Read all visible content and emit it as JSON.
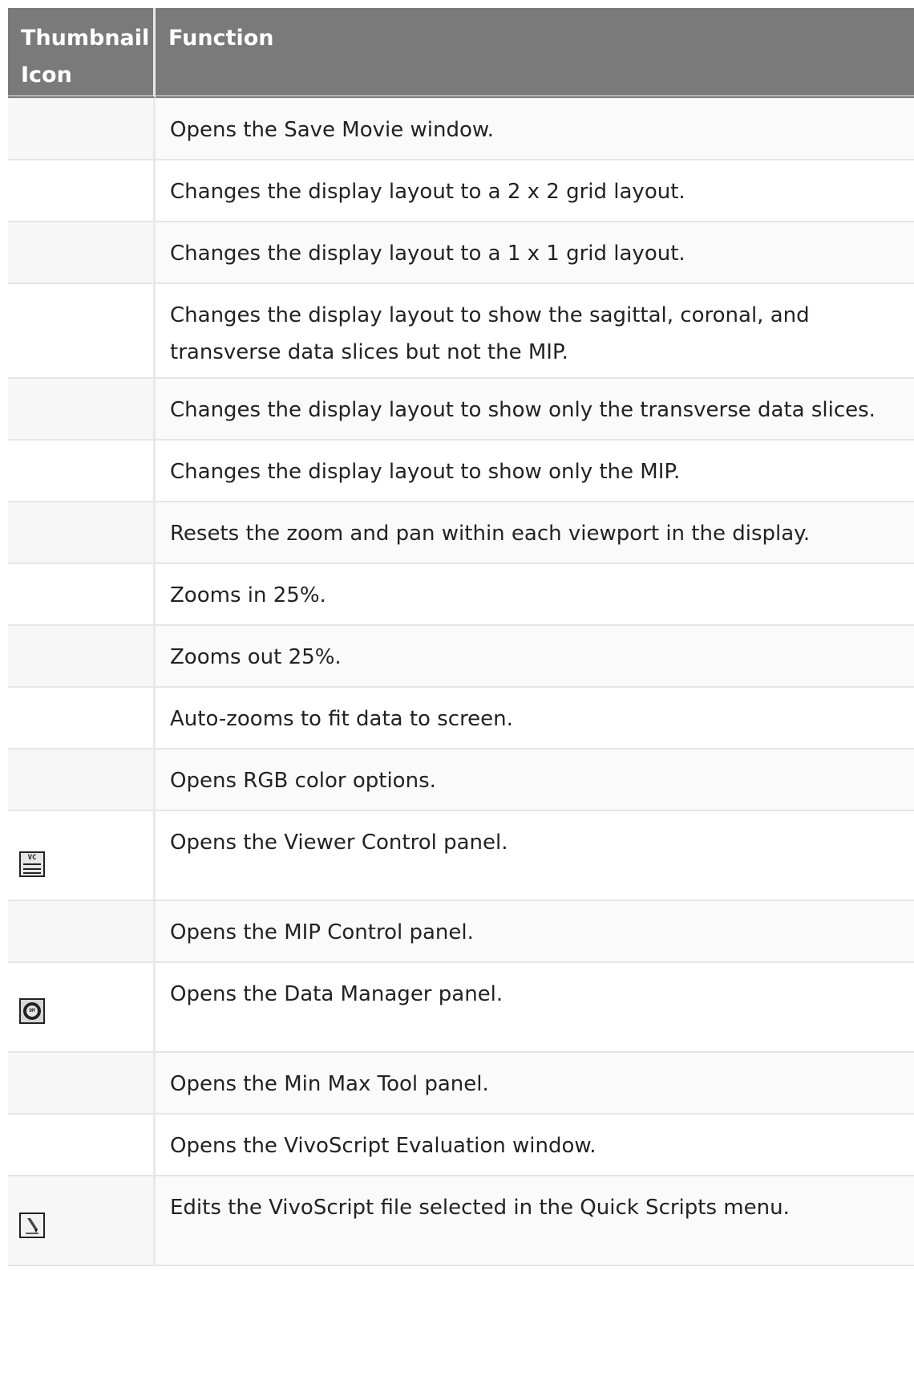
{
  "table": {
    "headers": [
      "Thumbnail Icon",
      "Function"
    ],
    "rows": [
      {
        "icon": "",
        "function": "Opens the Save Movie window."
      },
      {
        "icon": "",
        "function": "Changes the display layout to a 2 x 2 grid layout."
      },
      {
        "icon": "",
        "function": "Changes the display layout to a 1 x 1 grid layout."
      },
      {
        "icon": "",
        "function": "Changes the display layout to show the sagittal, coronal, and transverse data slices but not the MIP."
      },
      {
        "icon": "",
        "function": "Changes the display layout to show only the transverse data slices."
      },
      {
        "icon": "",
        "function": "Changes the display layout to show only the MIP."
      },
      {
        "icon": "",
        "function": "Resets the zoom and pan within each viewport in the display."
      },
      {
        "icon": "",
        "function": "Zooms in 25%."
      },
      {
        "icon": "",
        "function": "Zooms out 25%."
      },
      {
        "icon": "",
        "function": "Auto-zooms to fit data to screen."
      },
      {
        "icon": "",
        "function": "Opens RGB color options."
      },
      {
        "icon": "viewer-control-icon",
        "icon_text": "VC",
        "function": "Opens the Viewer Control panel."
      },
      {
        "icon": "",
        "function": "Opens the MIP Control panel."
      },
      {
        "icon": "data-manager-icon",
        "icon_text": "DM",
        "function": "Opens the Data Manager panel."
      },
      {
        "icon": "",
        "function": "Opens the Min Max Tool panel."
      },
      {
        "icon": "",
        "function": "Opens the VivoScript Evaluation window."
      },
      {
        "icon": "edit-script-icon",
        "function": "Edits the VivoScript file selected in the Quick Scripts menu."
      }
    ]
  },
  "colors": {
    "header_bg": "#7a7a7a",
    "header_text": "#ffffff",
    "border": "#e6e6e6"
  }
}
